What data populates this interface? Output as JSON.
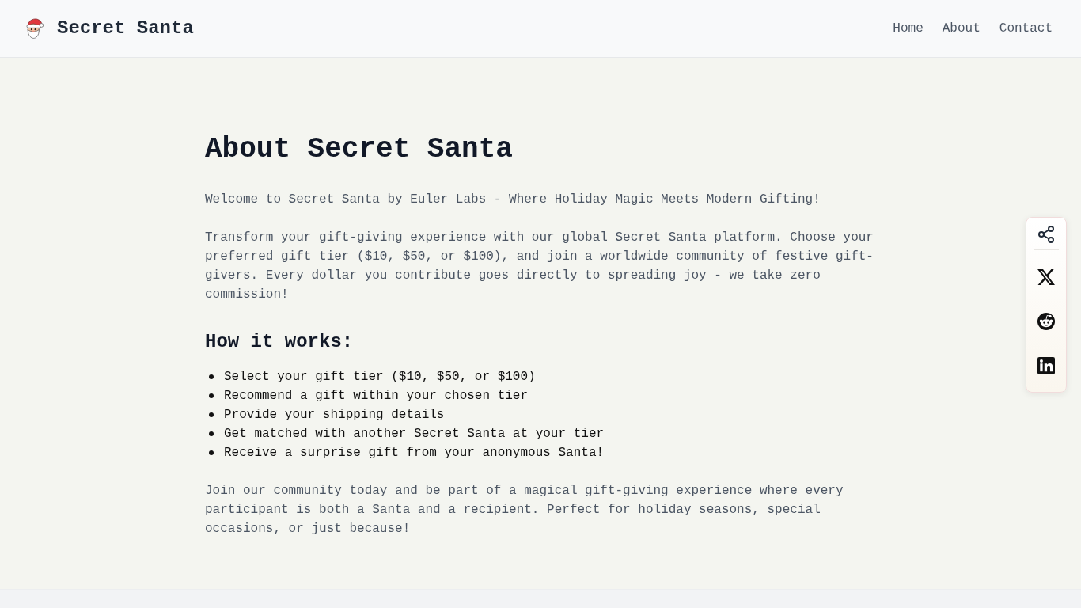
{
  "header": {
    "logo": "Secret Santa",
    "nav": [
      {
        "label": "Home"
      },
      {
        "label": "About"
      },
      {
        "label": "Contact"
      }
    ]
  },
  "main": {
    "title": "About Secret Santa",
    "intro": [
      "Welcome to Secret Santa by Euler Labs - Where Holiday Magic Meets Modern Gifting!",
      "Transform your gift-giving experience with our global Secret Santa platform. Choose your preferred gift tier ($10, $50, or $100), and join a worldwide community of festive gift-givers. Every dollar you contribute goes directly to spreading joy - we take zero commission!"
    ],
    "section_heading": "How it works:",
    "steps": [
      "Select your gift tier ($10, $50, or $100)",
      "Recommend a gift within your chosen tier",
      "Provide your shipping details",
      "Get matched with another Secret Santa at your tier",
      "Receive a surprise gift from your anonymous Santa!"
    ],
    "closing": "Join our community today and be part of a magical gift-giving experience where every participant is both a Santa and a recipient. Perfect for holiday seasons, special occasions, or just because!"
  }
}
